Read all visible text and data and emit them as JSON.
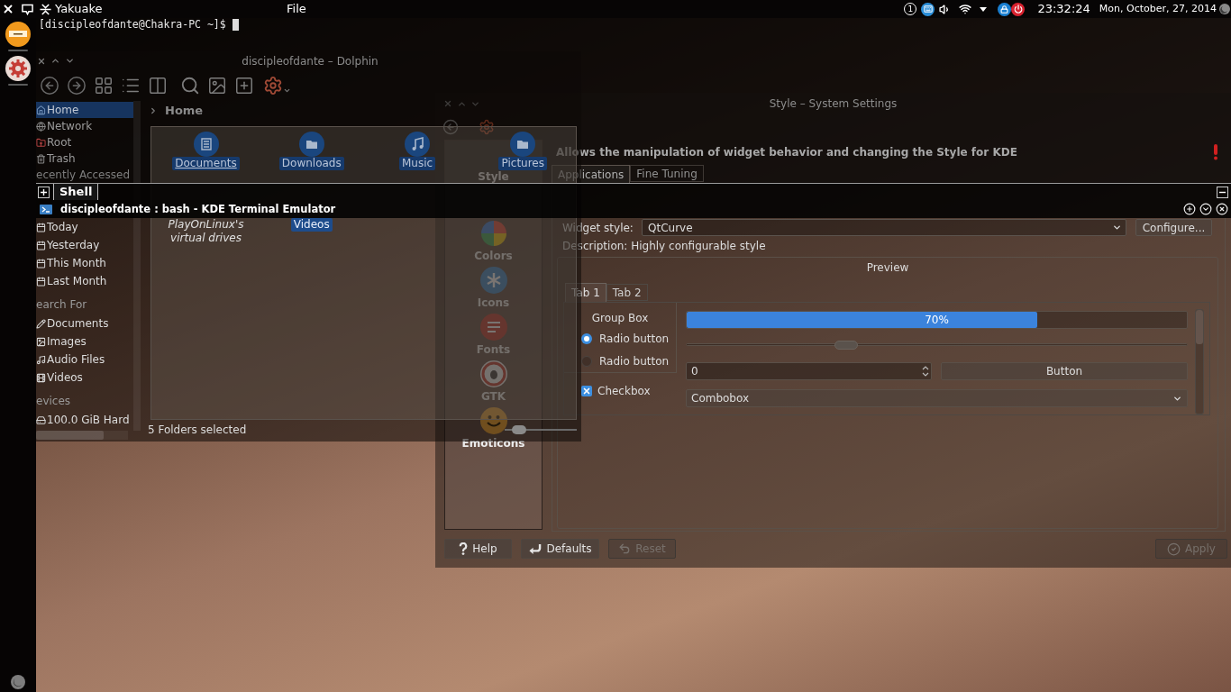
{
  "top_panel": {
    "app_title": "Yakuake",
    "menu": [
      "File"
    ],
    "pager": "1",
    "clock": "23:32:24",
    "date": "Mon, October, 27, 2014"
  },
  "terminal": {
    "prompt": "[discipleofdante@Chakra-PC ~]$",
    "tabs": [
      {
        "label": "Shell",
        "selected": true
      }
    ],
    "title": "discipleofdante : bash - KDE Terminal Emulator"
  },
  "dolphin": {
    "title": "discipleofdante – Dolphin",
    "breadcrumb": "Home",
    "places": [
      {
        "label": "Home",
        "selected": true
      },
      {
        "label": "Network",
        "selected": false
      },
      {
        "label": "Root",
        "selected": false
      },
      {
        "label": "Trash",
        "selected": false
      }
    ],
    "sections": [
      {
        "heading": "ecently Accessed",
        "items": [
          {
            "label": "Today",
            "selected": false
          },
          {
            "label": "Yesterday",
            "selected": false
          },
          {
            "label": "This Month",
            "selected": false
          },
          {
            "label": "Last Month",
            "selected": false
          }
        ]
      },
      {
        "heading": "earch For",
        "items": [
          {
            "label": "Documents",
            "selected": false
          },
          {
            "label": "Images",
            "selected": false
          },
          {
            "label": "Audio Files",
            "selected": false
          },
          {
            "label": "Videos",
            "selected": false
          }
        ]
      },
      {
        "heading": "evices",
        "items": [
          {
            "label": "100.0 GiB Hard",
            "selected": false
          }
        ]
      }
    ],
    "files": [
      {
        "name": "Documents",
        "kind": "folder",
        "selected": true,
        "hovered": true
      },
      {
        "name": "Downloads",
        "kind": "folder",
        "selected": true,
        "hovered": false
      },
      {
        "name": "Music",
        "kind": "folder",
        "selected": true,
        "hovered": false
      },
      {
        "name": "Pictures",
        "kind": "folder",
        "selected": true,
        "hovered": false
      },
      {
        "name": "PlayOnLinux's virtual drives",
        "kind": "symlink",
        "selected": false,
        "hovered": false
      },
      {
        "name": "Videos",
        "kind": "folder",
        "selected": true,
        "hovered": false
      }
    ],
    "status": "5 Folders selected",
    "zoom_slider": {
      "level": 0.12
    }
  },
  "settings": {
    "title": "Style – System Settings",
    "categories": [
      {
        "label": "Style"
      },
      {
        "label": "Colors"
      },
      {
        "label": "Icons"
      },
      {
        "label": "Fonts"
      },
      {
        "label": "GTK"
      },
      {
        "label": "Emoticons"
      }
    ],
    "header": "Allows the manipulation of widget behavior and changing the Style for KDE",
    "tabs": [
      {
        "label": "Applications",
        "selected": true
      },
      {
        "label": "Fine Tuning",
        "selected": false
      }
    ],
    "widget_style": {
      "label": "Widget style:",
      "value": "QtCurve"
    },
    "configure_button": "Configure...",
    "description": "Description: Highly configurable style",
    "preview": {
      "title": "Preview",
      "tabs": [
        {
          "label": "Tab 1",
          "selected": true
        },
        {
          "label": "Tab 2",
          "selected": false
        }
      ],
      "group_box": "Group Box",
      "radios": [
        {
          "label": "Radio button",
          "selected": true
        },
        {
          "label": "Radio button",
          "selected": false
        }
      ],
      "checkbox": {
        "label": "Checkbox",
        "checked": true
      },
      "progress": {
        "level": 0.7,
        "label": "70%"
      },
      "slider": {
        "level": 0.31
      },
      "spinbox": {
        "value": "0"
      },
      "button": "Button",
      "combobox": {
        "value": "Combobox"
      }
    },
    "buttons_left": [
      {
        "label": "Help",
        "disabled": false
      },
      {
        "label": "Defaults",
        "disabled": false
      },
      {
        "label": "Reset",
        "disabled": true
      }
    ],
    "buttons_right": [
      {
        "label": "Apply",
        "disabled": true
      }
    ]
  }
}
